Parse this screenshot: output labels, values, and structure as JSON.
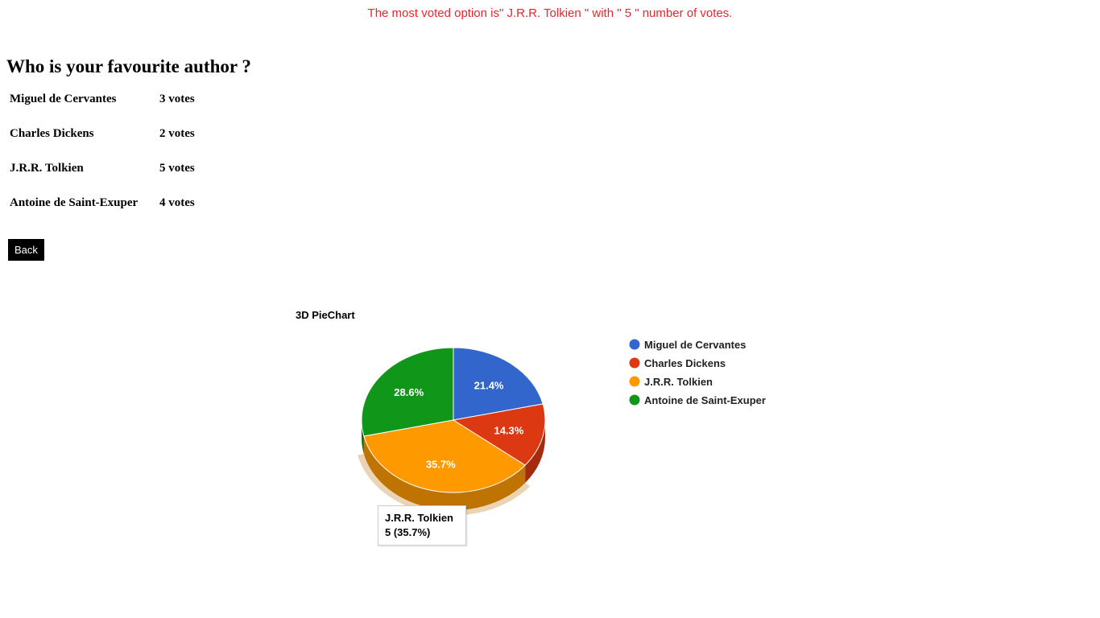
{
  "banner": {
    "text": "The most voted option is\" J.R.R. Tolkien \" with \" 5 \" number of votes."
  },
  "question": "Who is your favourite author ?",
  "results": [
    {
      "name": "Miguel de Cervantes",
      "votes": "3 votes"
    },
    {
      "name": "Charles Dickens",
      "votes": "2 votes"
    },
    {
      "name": "J.R.R. Tolkien",
      "votes": "5 votes"
    },
    {
      "name": "Antoine de Saint-Exuper",
      "votes": "4 votes"
    }
  ],
  "back_button": "Back",
  "tooltip": {
    "line1": "J.R.R. Tolkien",
    "line2": "5 (35.7%)"
  },
  "chart_data": {
    "type": "pie",
    "title": "3D PieChart",
    "is_3d": true,
    "legend_position": "right",
    "categories": [
      "Miguel de Cervantes",
      "Charles Dickens",
      "J.R.R. Tolkien",
      "Antoine de Saint-Exuper"
    ],
    "values": [
      3,
      2,
      5,
      4
    ],
    "labels": [
      "21.4%",
      "14.3%",
      "35.7%",
      "28.6%"
    ],
    "colors": [
      "#3366cc",
      "#dc3912",
      "#ff9900",
      "#109618"
    ],
    "side_colors": [
      "#264d99",
      "#a52b0e",
      "#bf7300",
      "#0c7112"
    ],
    "highlighted_category": "J.R.R. Tolkien"
  }
}
